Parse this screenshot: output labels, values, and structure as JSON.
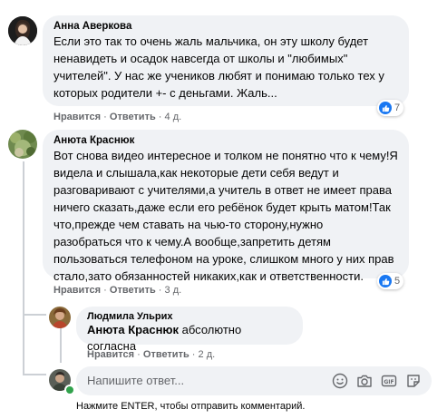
{
  "comments": [
    {
      "author": "Анна Аверкова",
      "lines": [
        "Если это так то очень жаль мальчика, он эту школу будет",
        "ненавидеть и осадок навсегда от школы и \"любимых\"",
        "учителей\". У нас же учеников любят и понимаю только тех у",
        "которых родители +- с деньгами. Жаль..."
      ],
      "like_label": "Нравится",
      "reply_label": "Ответить",
      "time": "4 д.",
      "reactions_count": "7"
    },
    {
      "author": "Анюта Краснюк",
      "lines": [
        "Вот снова видео интересное и толком не понятно что к чему!Я",
        "видела и слышала,как некоторые дети себя ведут и",
        "разговаривают с учителями,а учитель в ответ не имеет права",
        "ничего сказать,даже если его ребёнок будет крыть матом!Так",
        "что,прежде чем ставать на чью-то сторону,нужно",
        "разобраться что к чему.А вообще,запретить детям",
        "пользоваться телефоном на уроке, слишком много у них прав",
        "стало,зато обязанностей никаких,как и ответственности."
      ],
      "like_label": "Нравится",
      "reply_label": "Ответить",
      "time": "3 д.",
      "reactions_count": "5"
    }
  ],
  "reply": {
    "author": "Людмила Ульрих",
    "mention": "Анюта Краснюк",
    "text": "абсолютно согласна",
    "like_label": "Нравится",
    "reply_label": "Ответить",
    "time": "2 д."
  },
  "composer": {
    "placeholder": "Напишите ответ...",
    "hint": "Нажмите ENTER, чтобы отправить комментарий."
  },
  "separator": "·",
  "colors": {
    "like_blue": "#1877f2",
    "bubble_bg": "#f0f2f5",
    "meta_gray": "#65676b"
  }
}
